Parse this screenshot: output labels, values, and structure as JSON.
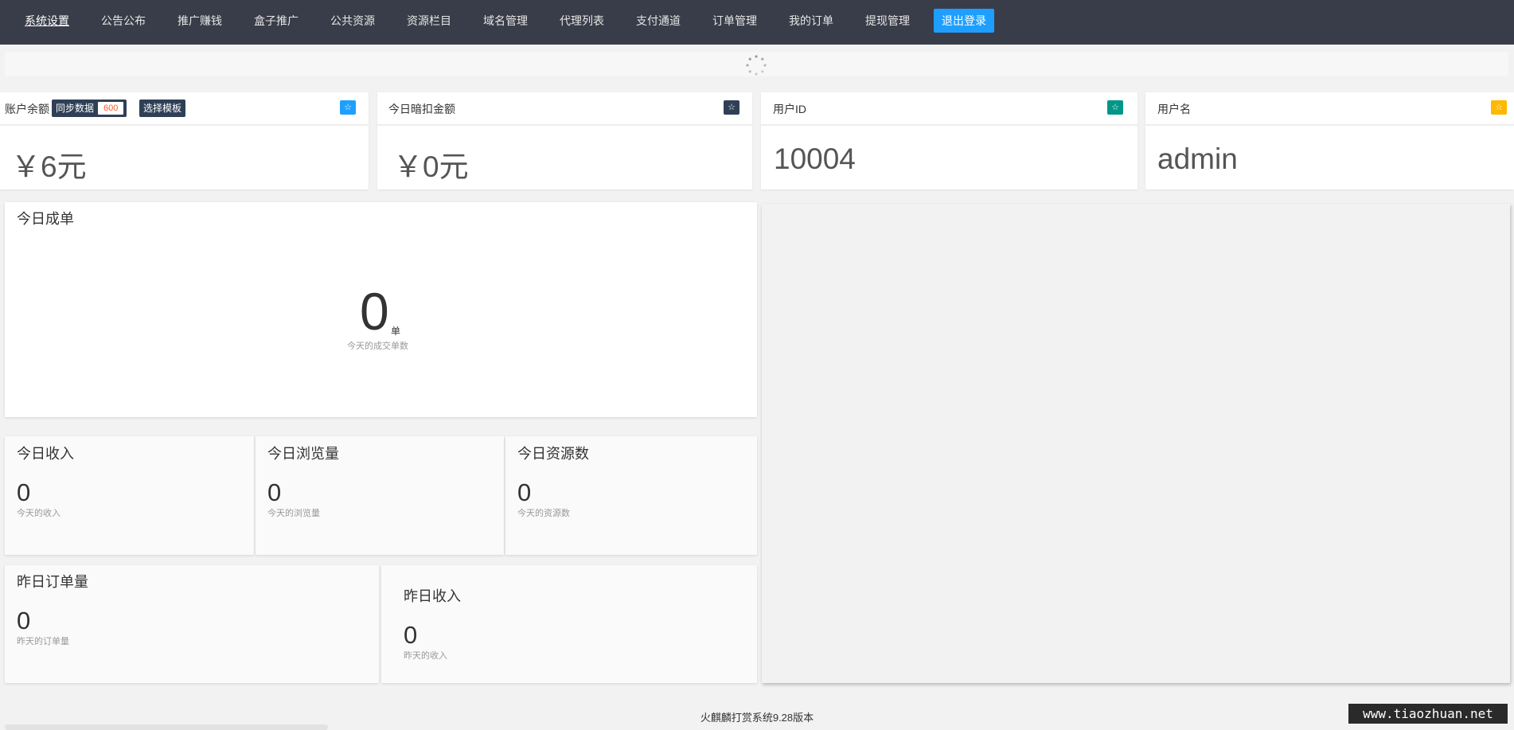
{
  "nav": {
    "items": [
      {
        "label": "系统设置"
      },
      {
        "label": "公告公布"
      },
      {
        "label": "推广赚钱"
      },
      {
        "label": "盒子推广"
      },
      {
        "label": "公共资源"
      },
      {
        "label": "资源栏目"
      },
      {
        "label": "域名管理"
      },
      {
        "label": "代理列表"
      },
      {
        "label": "支付通道"
      },
      {
        "label": "订单管理"
      },
      {
        "label": "我的订单"
      },
      {
        "label": "提现管理"
      }
    ],
    "active_index": 0,
    "logout_label": "退出登录"
  },
  "stats": {
    "balance": {
      "title": "账户余额",
      "sync_label": "同步数据",
      "sync_count": "600",
      "template_label": "选择模板",
      "value": "￥6元",
      "badge_color": "#1e9fff"
    },
    "deduct": {
      "title": "今日暗扣金额",
      "value": "￥0元",
      "badge_color": "#2f4056"
    },
    "userid": {
      "title": "用户ID",
      "value": "10004",
      "badge_color": "#009688"
    },
    "username": {
      "title": "用户名",
      "value": "admin",
      "badge_color": "#ffb800"
    }
  },
  "star_icon": "☆",
  "today_orders": {
    "title": "今日成单",
    "value": "0",
    "unit": "单",
    "caption": "今天的成交单数"
  },
  "today_income": {
    "title": "今日收入",
    "value": "0",
    "caption": "今天的收入"
  },
  "today_views": {
    "title": "今日浏览量",
    "value": "0",
    "caption": "今天的浏览量"
  },
  "today_resources": {
    "title": "今日资源数",
    "value": "0",
    "caption": "今天的资源数"
  },
  "yesterday_orders": {
    "title": "昨日订单量",
    "value": "0",
    "caption": "昨天的订单量"
  },
  "yesterday_income": {
    "title": "昨日收入",
    "value": "0",
    "caption": "昨天的收入"
  },
  "footer": {
    "version": "火麒麟打赏系统9.28版本"
  },
  "watermark": "www.tiaozhuan.net"
}
